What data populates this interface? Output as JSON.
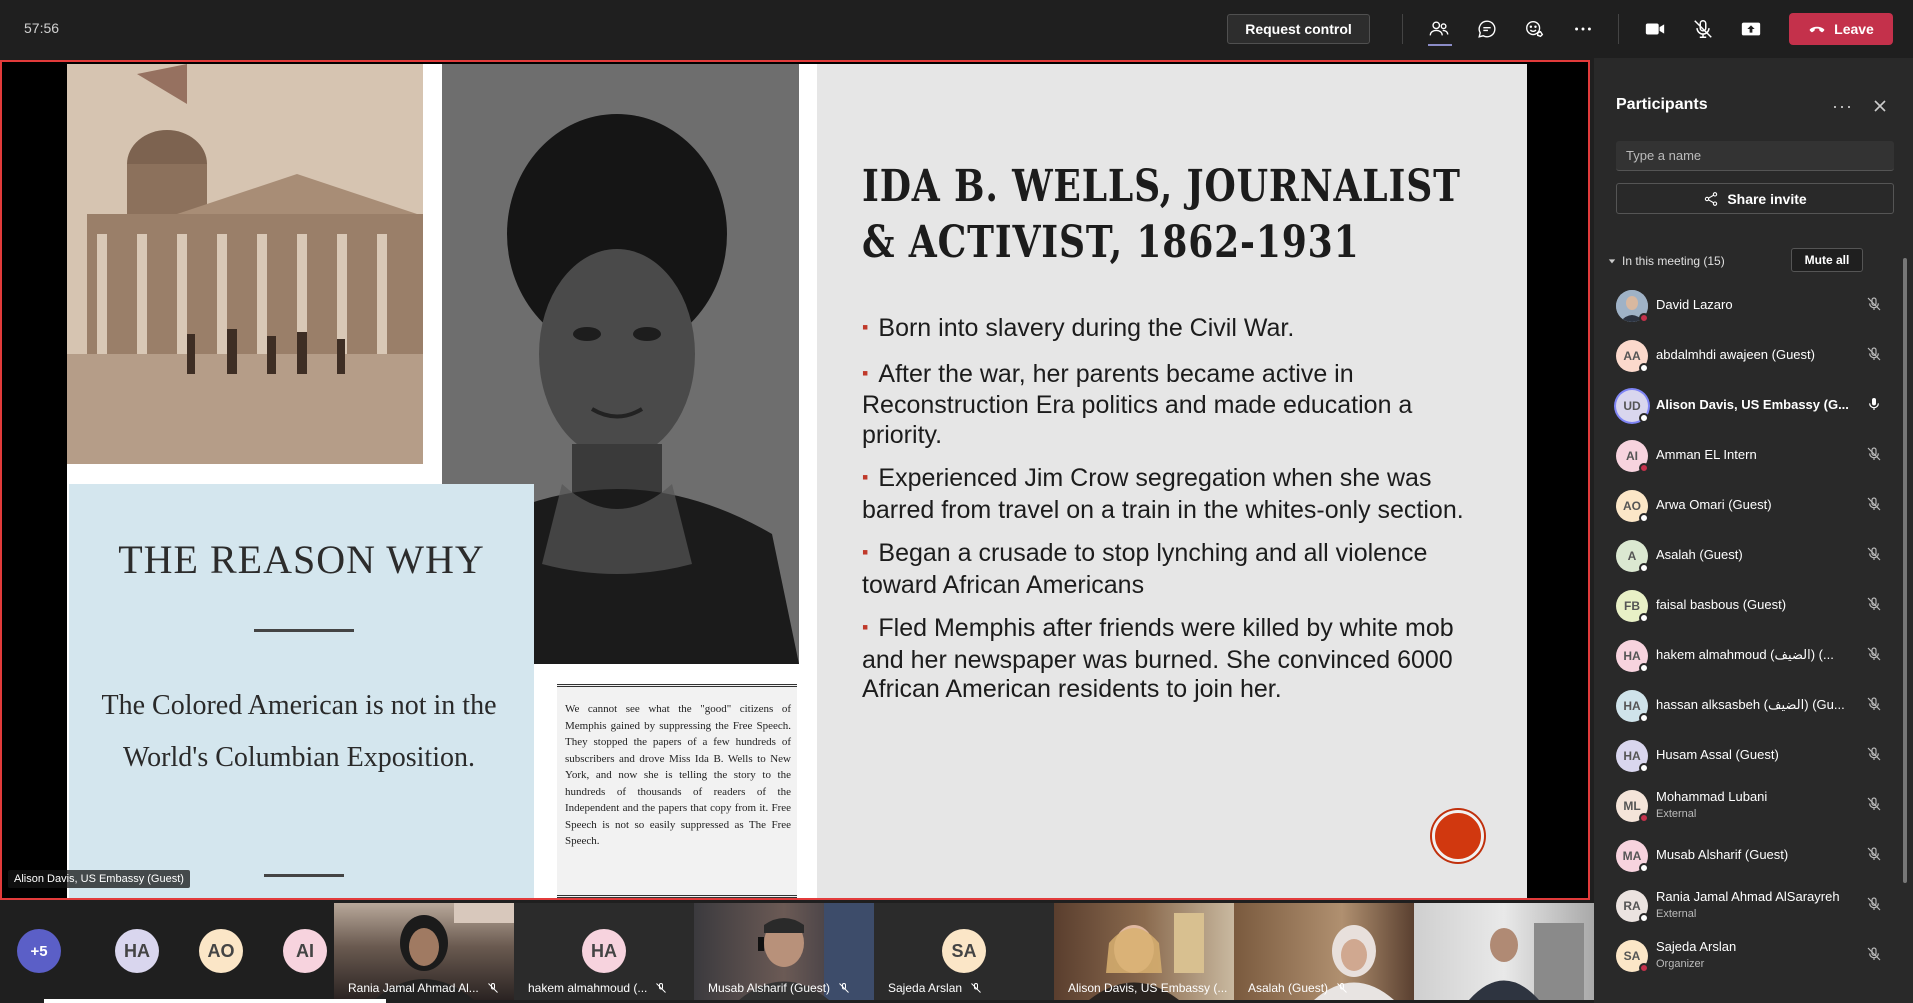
{
  "meeting": {
    "timer": "57:56",
    "request_control_label": "Request control",
    "leave_label": "Leave"
  },
  "toolbar_icons": [
    "people-icon",
    "chat-icon",
    "reactions-icon",
    "more-icon",
    "camera-icon",
    "mic-off-icon",
    "share-tray-icon"
  ],
  "slide": {
    "title_line1": "IDA B. WELLS, JOURNALIST",
    "title_line2": "& ACTIVIST, 1862-1931",
    "bullets": [
      "Born into slavery during the Civil War.",
      "After the war, her parents became active in Reconstruction Era politics and made education a priority.",
      "Experienced Jim Crow segregation when she was barred from travel on a train in the whites-only section.",
      "Began a crusade to stop lynching and all violence toward African Americans",
      "Fled Memphis after friends were killed by white mob and her newspaper was burned. She convinced 6000 African American residents to join her."
    ],
    "pamphlet_title": "THE REASON WHY",
    "pamphlet_text": "The Colored American is not in the World's Columbian Exposition.",
    "clipping_text": "We cannot see what the \"good\" citizens of Memphis gained by suppressing the Free Speech. They stopped the papers of a few hundreds of subscribers and drove Miss Ida B. Wells to New York, and now she is telling the story to the hundreds of thousands of readers of the Independent and the papers that copy from it. Free Speech is not so easily suppressed as The Free Speech."
  },
  "presenter_label": "Alison Davis, US Embassy (Guest)",
  "strip": {
    "more_count": "+5",
    "avatars": [
      {
        "initials": "HA",
        "bg": "#d9d6ee"
      },
      {
        "initials": "AO",
        "bg": "#fbe6c7"
      },
      {
        "initials": "AI",
        "bg": "#f7d3de"
      }
    ],
    "tiles": [
      {
        "name": "Rania Jamal Ahmad Al..."
      },
      {
        "name": "hakem almahmoud (...",
        "initials": "HA",
        "bg": "#f7d3de"
      },
      {
        "name": "Musab Alsharif (Guest)"
      },
      {
        "name": "Sajeda Arslan",
        "initials": "SA",
        "bg": "#fbe6c7"
      },
      {
        "name": "Alison Davis, US Embassy (..."
      },
      {
        "name": "Asalah (Guest)"
      },
      {
        "name": ""
      }
    ]
  },
  "panel": {
    "title": "Participants",
    "search_placeholder": "Type a name",
    "share_invite_label": "Share invite",
    "section_label": "In this meeting (15)",
    "mute_all_label": "Mute all",
    "participants": [
      {
        "initials": "",
        "name": "David Lazaro",
        "sub": "",
        "bg": "#8aa0b8",
        "dot": "#c4314b",
        "photo": true
      },
      {
        "initials": "AA",
        "name": "abdalmhdi awajeen (Guest)",
        "sub": "",
        "bg": "#fbd9cc",
        "dot": "#ffffff"
      },
      {
        "initials": "UD",
        "name": "Alison Davis, US Embassy (G...",
        "sub": "",
        "bg": "#d9d6ee",
        "dot": "#ffffff",
        "bold": true,
        "mic_on": true
      },
      {
        "initials": "AI",
        "name": "Amman EL Intern",
        "sub": "",
        "bg": "#f7d3de",
        "dot": "#c4314b"
      },
      {
        "initials": "AO",
        "name": "Arwa Omari (Guest)",
        "sub": "",
        "bg": "#fbe6c7",
        "dot": "#ffffff"
      },
      {
        "initials": "A",
        "name": "Asalah (Guest)",
        "sub": "",
        "bg": "#dbe8d1",
        "dot": "#ffffff"
      },
      {
        "initials": "FB",
        "name": "faisal basbous (Guest)",
        "sub": "",
        "bg": "#e8f0c6",
        "dot": "#ffffff"
      },
      {
        "initials": "HA",
        "name": "hakem almahmoud (الضيف) (...",
        "sub": "",
        "bg": "#f7d3de",
        "dot": "#ffffff"
      },
      {
        "initials": "HA",
        "name": "hassan alksasbeh (الضيف) (Gu...",
        "sub": "",
        "bg": "#cfe3ea",
        "dot": "#ffffff"
      },
      {
        "initials": "HA",
        "name": "Husam Assal (Guest)",
        "sub": "",
        "bg": "#d9d6ee",
        "dot": "#ffffff"
      },
      {
        "initials": "ML",
        "name": "Mohammad Lubani",
        "sub": "External",
        "bg": "#f4e4d9",
        "dot": "#c4314b"
      },
      {
        "initials": "MA",
        "name": "Musab Alsharif (Guest)",
        "sub": "",
        "bg": "#f7d3de",
        "dot": "#ffffff"
      },
      {
        "initials": "RA",
        "name": "Rania Jamal Ahmad AlSarayreh",
        "sub": "External",
        "bg": "#ebe3e0",
        "dot": "#ffffff"
      },
      {
        "initials": "SA",
        "name": "Sajeda Arslan",
        "sub": "Organizer",
        "bg": "#fbe6c7",
        "dot": "#c4314b"
      }
    ]
  }
}
